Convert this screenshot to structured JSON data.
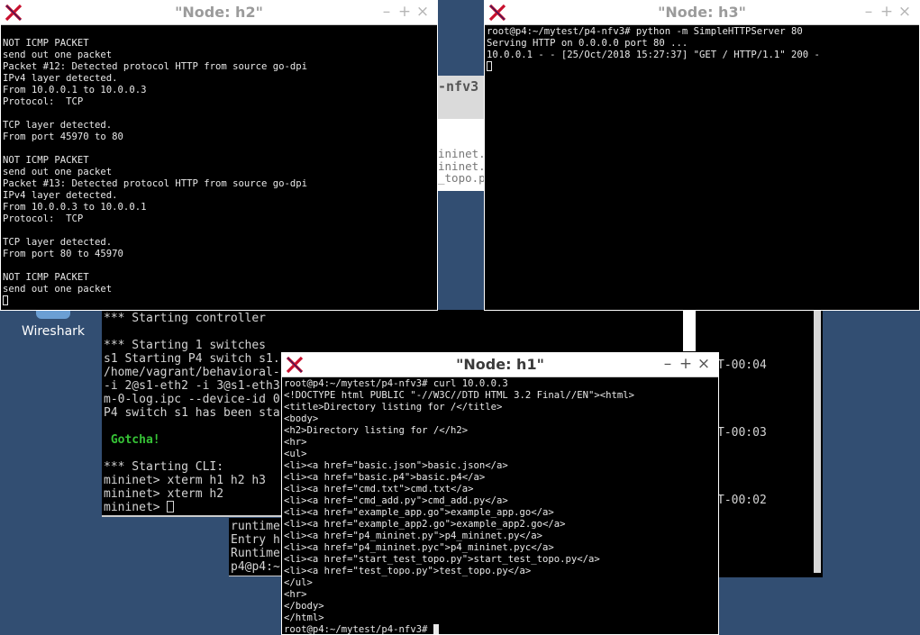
{
  "desktop": {
    "wireshark_label": "Wireshark"
  },
  "gray_window": {
    "title_fragment": "-nfv3",
    "file_lines": [
      "ininet.p",
      "ininet.p",
      "_topo.p"
    ]
  },
  "mininet_terminal": {
    "lines": [
      "*** Starting controller",
      "",
      "*** Starting 1 switches",
      "s1 Starting P4 switch s1.",
      "/home/vagrant/behavioral-",
      "-i 2@s1-eth2 -i 3@s1-eth3",
      "m-0-log.ipc --device-id 0",
      "P4 switch s1 has been sta",
      "",
      " Gotcha!",
      "",
      "*** Starting CLI:",
      "mininet> xterm h1 h2 h3",
      "mininet> xterm h2",
      "mininet> "
    ],
    "gotcha_color": "#36c236"
  },
  "right_background_terminal": {
    "timestamps": [
      "T-00:04",
      "T-00:03",
      "T-00:02"
    ]
  },
  "runtime_terminal": {
    "lines": [
      "runtime",
      "Entry h",
      "Runtime",
      "p4@p4:~"
    ]
  },
  "h2_window": {
    "title": "\"Node: h2\"",
    "buttons": [
      "–",
      "+",
      "×"
    ],
    "lines": [
      "",
      "NOT ICMP PACKET",
      "send out one packet",
      "Packet #12: Detected protocol HTTP from source go-dpi",
      "IPv4 layer detected.",
      "From 10.0.0.1 to 10.0.0.3",
      "Protocol:  TCP",
      "",
      "TCP layer detected.",
      "From port 45970 to 80",
      "",
      "NOT ICMP PACKET",
      "send out one packet",
      "Packet #13: Detected protocol HTTP from source go-dpi",
      "IPv4 layer detected.",
      "From 10.0.0.3 to 10.0.0.1",
      "Protocol:  TCP",
      "",
      "TCP layer detected.",
      "From port 80 to 45970",
      "",
      "NOT ICMP PACKET",
      "send out one packet"
    ]
  },
  "h3_window": {
    "title": "\"Node: h3\"",
    "buttons": [
      "–",
      "+",
      "×"
    ],
    "lines": [
      "root@p4:~/mytest/p4-nfv3# python -m SimpleHTTPServer 80",
      "Serving HTTP on 0.0.0.0 port 80 ...",
      "10.0.0.1 - - [25/Oct/2018 15:27:37] \"GET / HTTP/1.1\" 200 -"
    ]
  },
  "h1_window": {
    "title": "\"Node: h1\"",
    "buttons": [
      "–",
      "+",
      "×"
    ],
    "lines": [
      "root@p4:~/mytest/p4-nfv3# curl 10.0.0.3",
      "<!DOCTYPE html PUBLIC \"-//W3C//DTD HTML 3.2 Final//EN\"><html>",
      "<title>Directory listing for /</title>",
      "<body>",
      "<h2>Directory listing for /</h2>",
      "<hr>",
      "<ul>",
      "<li><a href=\"basic.json\">basic.json</a>",
      "<li><a href=\"basic.p4\">basic.p4</a>",
      "<li><a href=\"cmd.txt\">cmd.txt</a>",
      "<li><a href=\"cmd_add.py\">cmd_add.py</a>",
      "<li><a href=\"example_app.go\">example_app.go</a>",
      "<li><a href=\"example_app2.go\">example_app2.go</a>",
      "<li><a href=\"p4_mininet.py\">p4_mininet.py</a>",
      "<li><a href=\"p4_mininet.pyc\">p4_mininet.pyc</a>",
      "<li><a href=\"start_test_topo.py\">start_test_topo.py</a>",
      "<li><a href=\"test_topo.py\">test_topo.py</a>",
      "</ul>",
      "<hr>",
      "</body>",
      "</html>"
    ],
    "prompt": "root@p4:~/mytest/p4-nfv3# "
  },
  "colors": {
    "desktop": "#324e72",
    "terminal_bg": "#000000",
    "titlebar_bg": "#ffffff",
    "xterm_icon_red": "#c8102e"
  }
}
